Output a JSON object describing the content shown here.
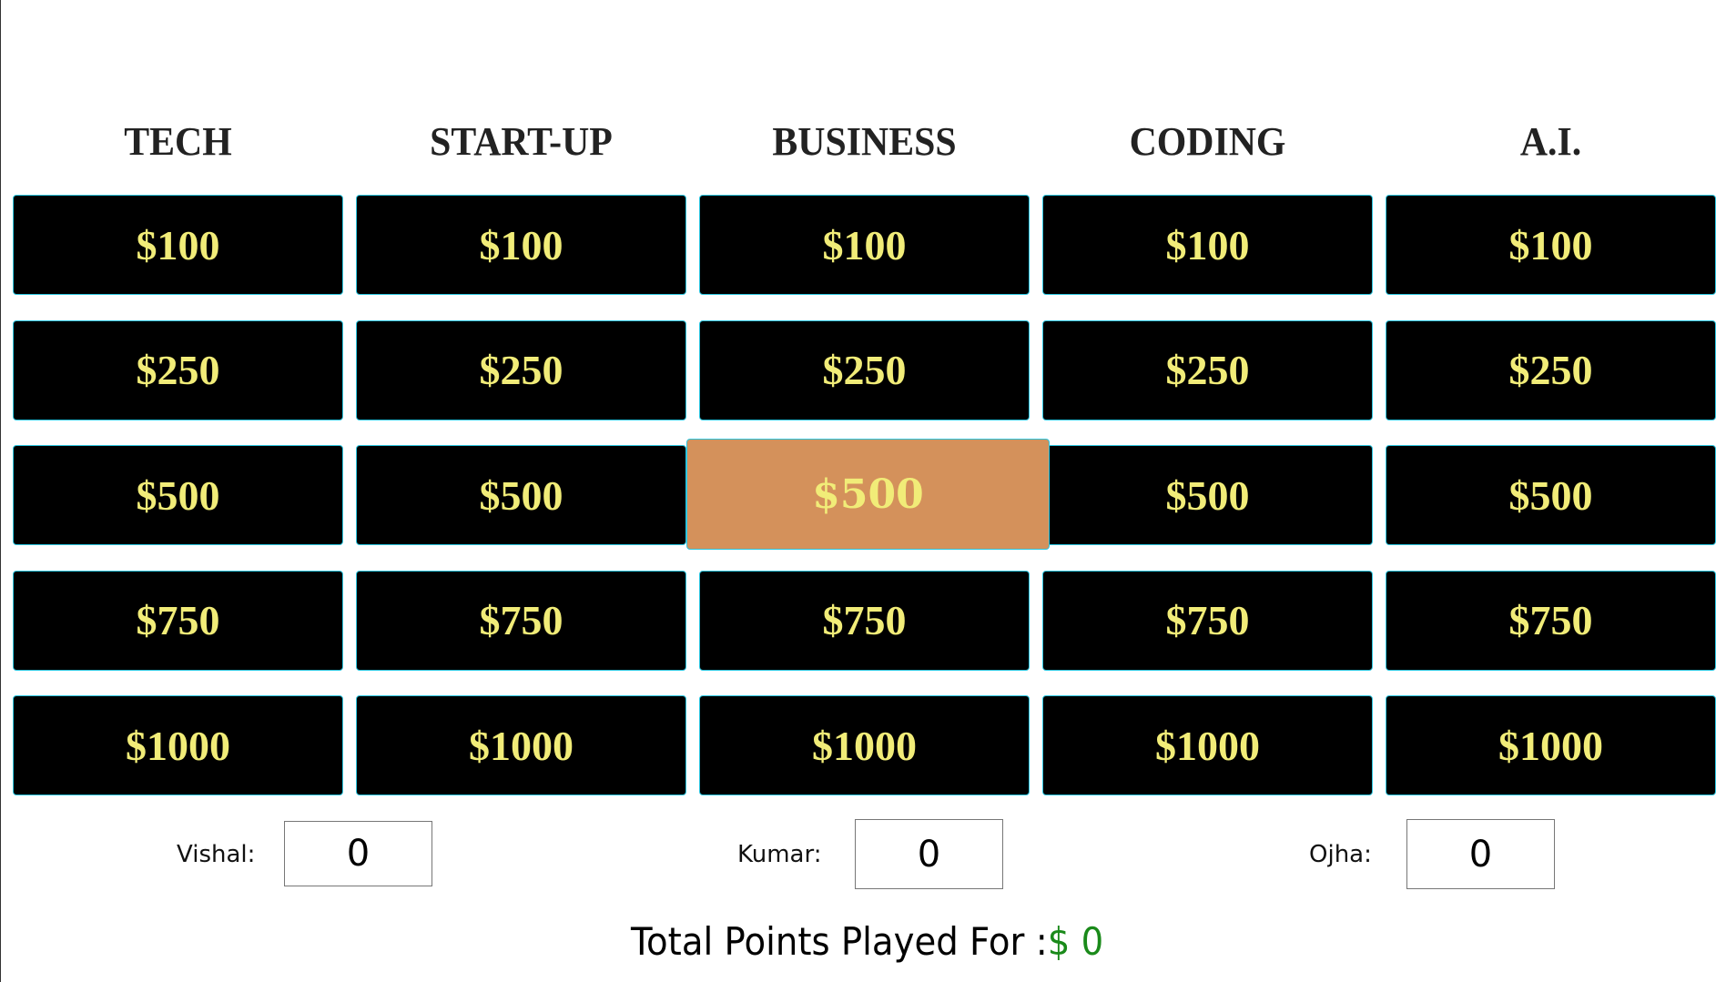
{
  "categories": [
    "TECH",
    "START-UP",
    "BUSINESS",
    "CODING",
    "A.I."
  ],
  "values": [
    "$100",
    "$250",
    "$500",
    "$750",
    "$1000"
  ],
  "active_cell": {
    "category": "BUSINESS",
    "value": "$500"
  },
  "colors": {
    "card_bg": "#000000",
    "card_text": "#f1ec78",
    "card_border": "#2cc6e0",
    "active_bg": "#d4915b",
    "total_amount": "#1a8a1a"
  },
  "players": [
    {
      "label": "Vishal:",
      "score": "0"
    },
    {
      "label": "Kumar:",
      "score": "0"
    },
    {
      "label": "Ojha:",
      "score": "0"
    }
  ],
  "total": {
    "label": "Total Points Played For :",
    "amount": "$ 0"
  }
}
